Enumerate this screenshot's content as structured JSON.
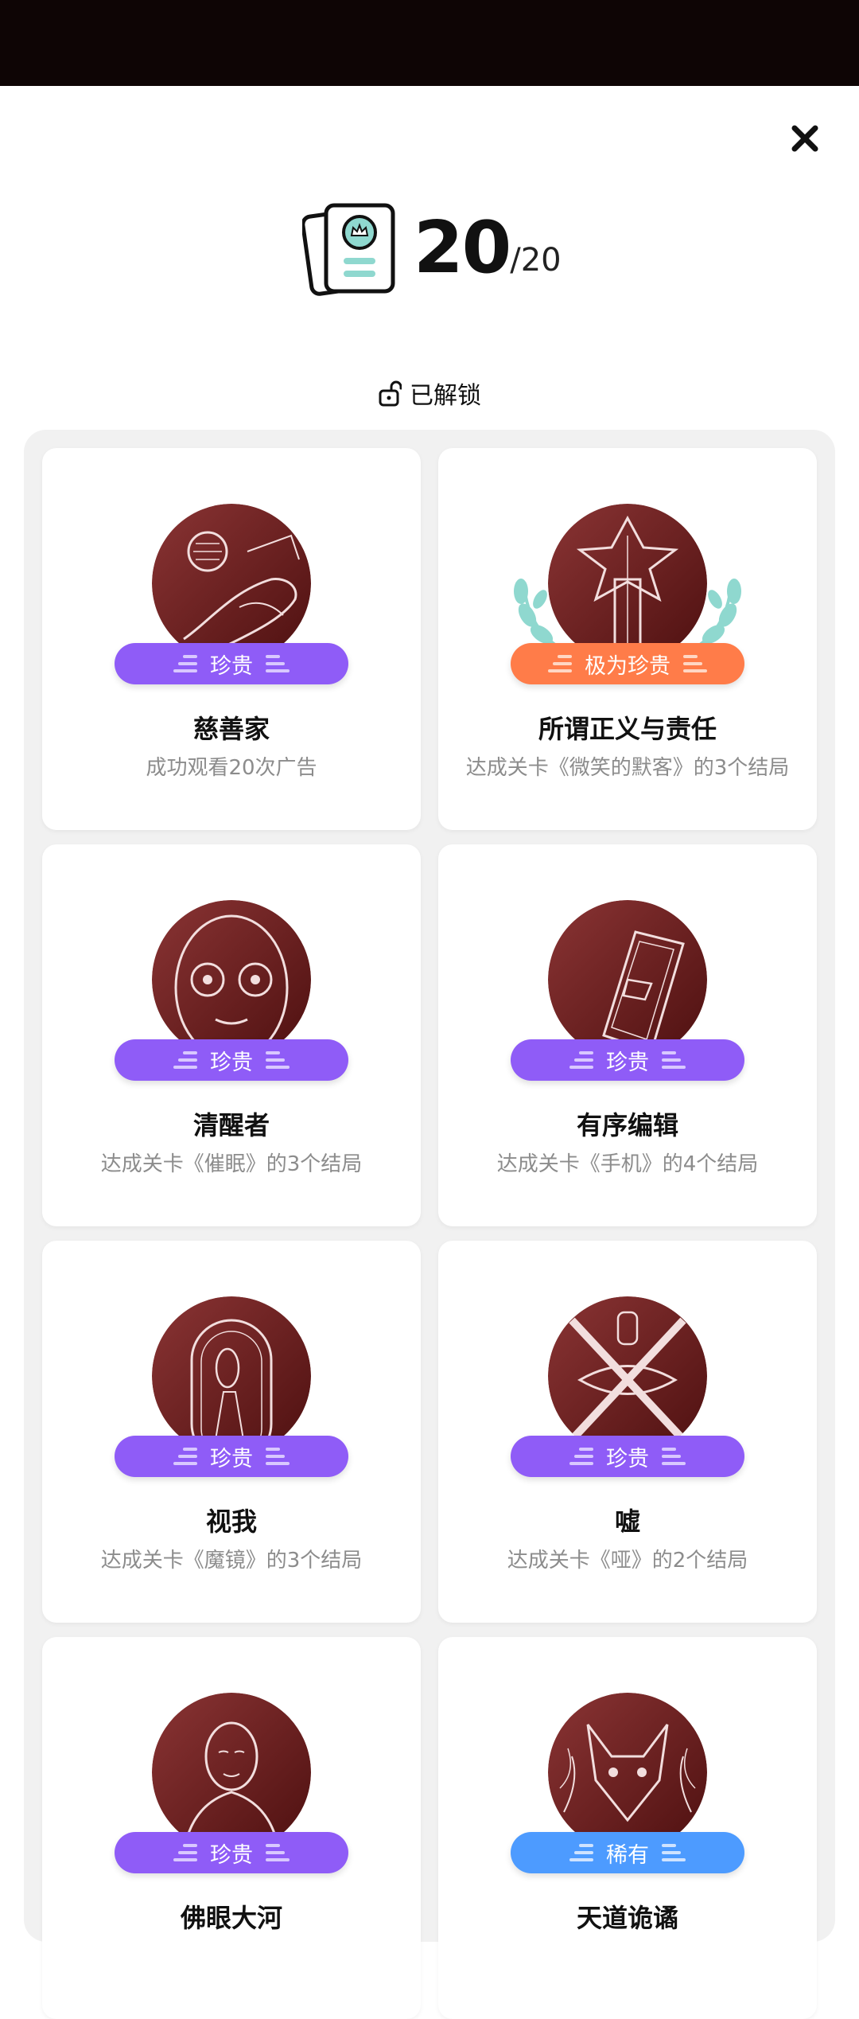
{
  "header": {
    "count": "20",
    "total": "/20",
    "unlocked_label": "已解锁"
  },
  "colors": {
    "rarity_precious": "#8f5cf7",
    "rarity_very_precious": "#ff7c49",
    "rarity_rare": "#4d9bff",
    "medal": "#6b1d1d",
    "laurel": "#8fd8cf"
  },
  "achievements": [
    {
      "title": "慈善家",
      "desc": "成功观看20次广告",
      "rarity": "珍贵",
      "icon": "hand-moon-icon"
    },
    {
      "title": "所谓正义与责任",
      "desc": "达成关卡《微笑的默客》的3个结局",
      "rarity": "极为珍贵",
      "icon": "sword-icon"
    },
    {
      "title": "清醒者",
      "desc": "达成关卡《催眠》的3个结局",
      "rarity": "珍贵",
      "icon": "face-icon"
    },
    {
      "title": "有序编辑",
      "desc": "达成关卡《手机》的4个结局",
      "rarity": "珍贵",
      "icon": "phone-icon"
    },
    {
      "title": "视我",
      "desc": "达成关卡《魔镜》的3个结局",
      "rarity": "珍贵",
      "icon": "mirror-icon"
    },
    {
      "title": "嘘",
      "desc": "达成关卡《哑》的2个结局",
      "rarity": "珍贵",
      "icon": "crossed-lips-icon"
    },
    {
      "title": "佛眼大河",
      "desc": "",
      "rarity": "珍贵",
      "icon": "buddha-icon"
    },
    {
      "title": "天道诡谲",
      "desc": "",
      "rarity": "稀有",
      "icon": "fox-icon"
    }
  ]
}
